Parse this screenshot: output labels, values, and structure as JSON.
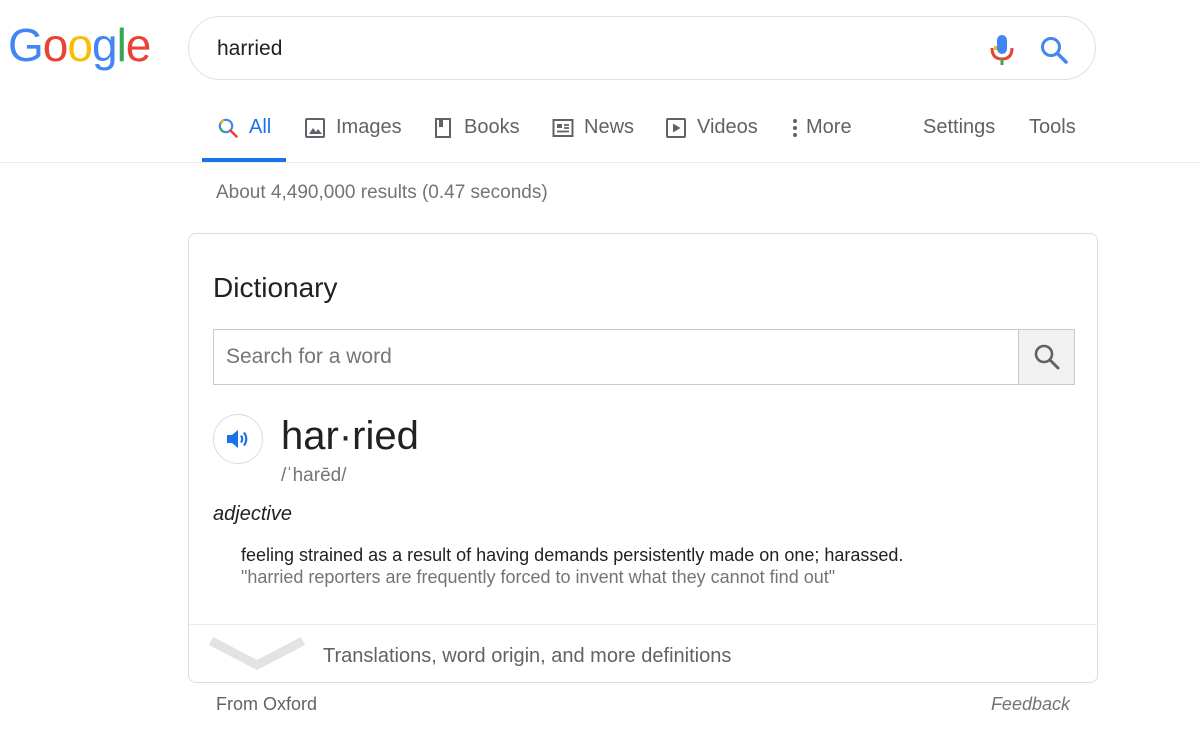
{
  "logo": {
    "letters": [
      "G",
      "o",
      "o",
      "g",
      "l",
      "e"
    ],
    "colors": [
      "#4285f4",
      "#ea4335",
      "#fbbc05",
      "#4285f4",
      "#34a853",
      "#ea4335"
    ]
  },
  "search": {
    "query": "harried"
  },
  "tabs": [
    {
      "label": "All",
      "icon": "search-icon",
      "active": true
    },
    {
      "label": "Images",
      "icon": "image-icon"
    },
    {
      "label": "Books",
      "icon": "book-icon"
    },
    {
      "label": "News",
      "icon": "newspaper-icon"
    },
    {
      "label": "Videos",
      "icon": "play-icon"
    },
    {
      "label": "More",
      "icon": "more-vertical-icon"
    }
  ],
  "tools": {
    "settings": "Settings",
    "tools": "Tools"
  },
  "result_stats": "About 4,490,000 results (0.47 seconds)",
  "dictionary": {
    "title": "Dictionary",
    "search_placeholder": "Search for a word",
    "headword": "har·ried",
    "phonetic": "/ˈharēd/",
    "part_of_speech": "adjective",
    "definition": "feeling strained as a result of having demands persistently made on one; harassed.",
    "example": "\"harried reporters are frequently forced to invent what they cannot find out\"",
    "more_label": "Translations, word origin, and more definitions"
  },
  "footer": {
    "source": "From Oxford",
    "feedback": "Feedback"
  },
  "colors": {
    "accent": "#1a73e8",
    "muted": "#70757a",
    "border": "#dadce0"
  }
}
